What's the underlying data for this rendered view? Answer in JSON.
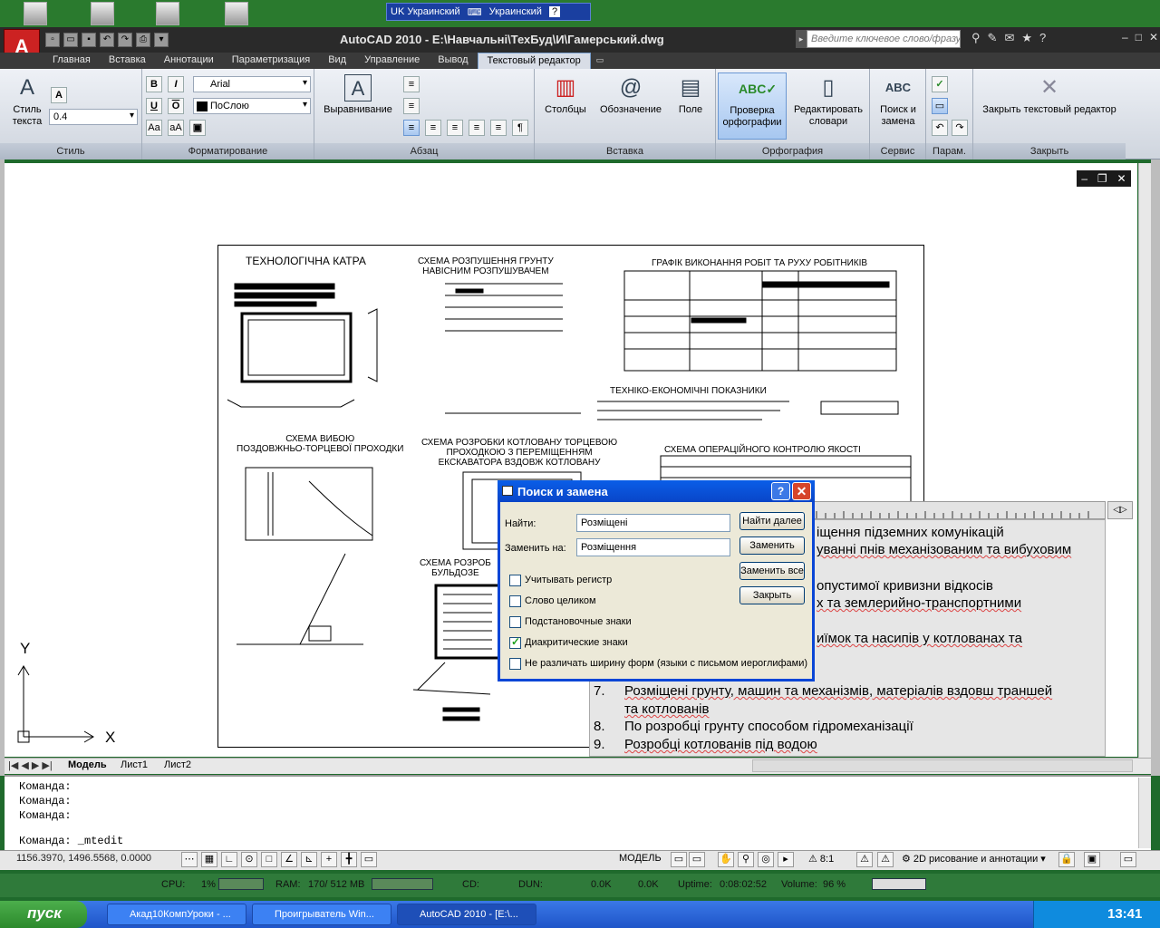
{
  "lang_bar": {
    "primary": "UK Украинский",
    "secondary": "Украинский",
    "help": "?"
  },
  "app": {
    "title": "AutoCAD 2010 - E:\\Навчальні\\ТехБуд\\И\\Гамерський.dwg",
    "logo": "A",
    "search_placeholder": "Введите ключевое слово/фразу"
  },
  "tabs": [
    "Главная",
    "Вставка",
    "Аннотации",
    "Параметризация",
    "Вид",
    "Управление",
    "Вывод",
    "Текстовый редактор"
  ],
  "ribbon": {
    "style_panel": {
      "title": "Стиль",
      "text_style": "Стиль текста",
      "height": "0.4"
    },
    "format_panel": {
      "title": "Форматирование",
      "font": "Arial",
      "color": "ПоСлою",
      "bold": "B",
      "italic": "I",
      "underline": "U",
      "overline": "O",
      "upper": "Aa",
      "lower": "aA"
    },
    "paragraph_panel": {
      "title": "Абзац",
      "align": "Выравнивание"
    },
    "insert_panel": {
      "title": "Вставка",
      "columns": "Столбцы",
      "symbol": "Обозначение",
      "field": "Поле"
    },
    "spell_panel": {
      "title": "Орфография",
      "check": "Проверка орфографии",
      "dicts": "Редактировать словари"
    },
    "tools_panel": {
      "title": "Сервис",
      "find": "Поиск и замена"
    },
    "options_panel": {
      "title": "Парам."
    },
    "close_panel": {
      "title": "Закрыть",
      "close": "Закрыть текстовый редактор"
    }
  },
  "drawing": {
    "titles": {
      "t1": "ТЕХНОЛОГІЧНА КАТРА",
      "t2": "СХЕМА РОЗПУШЕННЯ ГРУНТУ\nНАВІСНИМ РОЗПУШУВАЧЕМ",
      "t3": "ГРАФІК ВИКОНАННЯ РОБІТ ТА РУХУ РОБІТНИКІВ",
      "t4": "ТЕХНІКО-ЕКОНОМІЧНІ ПОКАЗНИКИ",
      "t5": "СХЕМА ВИБОЮ\nПОЗДОВЖНЬО-ТОРЦЕВОЇ ПРОХОДКИ",
      "t6": "СХЕМА РОЗРОБКИ КОТЛОВАНУ ТОРЦЕВОЮ\nПРОХОДКОЮ З ПЕРЕМІЩЕННЯМ\nЕКСКАВАТОРА ВЗДОВЖ КОТЛОВАНУ",
      "t7": "СХЕМА ОПЕРАЦІЙНОГО КОНТРОЛЮ ЯКОСТІ",
      "t8": "СХЕМА РОЗРОБ\nБУЛЬДОЗЕ"
    },
    "axis_y": "Y",
    "axis_x": "X"
  },
  "mtext": {
    "lines": [
      {
        "num": "",
        "text": "іщення підземних комунікацій"
      },
      {
        "num": "",
        "text": "уванні пнів механізованим та вибуховим"
      },
      {
        "num": "",
        "text": "опустимої кривизни відкосів"
      },
      {
        "num": "",
        "text": "х та землерийно-транспортними"
      },
      {
        "num": "",
        "text": "иїмок та насипів у котлованах та"
      },
      {
        "num": "7.",
        "text": "Розміщені грунту, машин та механізмів, матеріалів вздовш траншей"
      },
      {
        "num": "",
        "text": "та котлованів"
      },
      {
        "num": "8.",
        "text": "По розробці грунту способом гідромеханізації"
      },
      {
        "num": "9.",
        "text": "Розробці котлованів під водою"
      }
    ]
  },
  "dialog": {
    "title": "Поиск и замена",
    "find_label": "Найти:",
    "find_value": "Розміщені",
    "replace_label": "Заменить на:",
    "replace_value": "Розміщення",
    "btn_find_next": "Найти далее",
    "btn_replace": "Заменить",
    "btn_replace_all": "Заменить все",
    "btn_close": "Закрыть",
    "options": [
      {
        "label": "Учитывать регистр",
        "checked": false
      },
      {
        "label": "Слово целиком",
        "checked": false
      },
      {
        "label": "Подстановочные знаки",
        "checked": false
      },
      {
        "label": "Диакритические знаки",
        "checked": true
      },
      {
        "label": "Не различать ширину форм (языки с письмом иероглифами)",
        "checked": false
      }
    ]
  },
  "layout_tabs": [
    "Модель",
    "Лист1",
    "Лист2"
  ],
  "command": {
    "lines": [
      "Команда:",
      "Команда:",
      "Команда:"
    ],
    "prompt": "Команда:  _mtedit"
  },
  "status": {
    "coords": "1156.3970, 1496.5568, 0.0000",
    "model": "МОДЕЛЬ",
    "scale": "8:1",
    "workspace": "2D рисование и аннотации"
  },
  "monitor": {
    "cpu_label": "CPU:",
    "cpu_value": "1%",
    "ram_label": "RAM:",
    "ram_value": "170/ 512 MB",
    "cd_label": "CD:",
    "dun_label": "DUN:",
    "down": "0.0K",
    "up": "0.0K",
    "uptime_label": "Uptime:",
    "uptime": "0:08:02:52",
    "volume_label": "Volume:",
    "volume": "96 %"
  },
  "taskbar": {
    "start": "пуск",
    "tasks": [
      "Акад10КомпУроки - ...",
      "Проигрыватель Win...",
      "AutoCAD 2010 - [E:\\..."
    ],
    "clock": "13:41"
  }
}
